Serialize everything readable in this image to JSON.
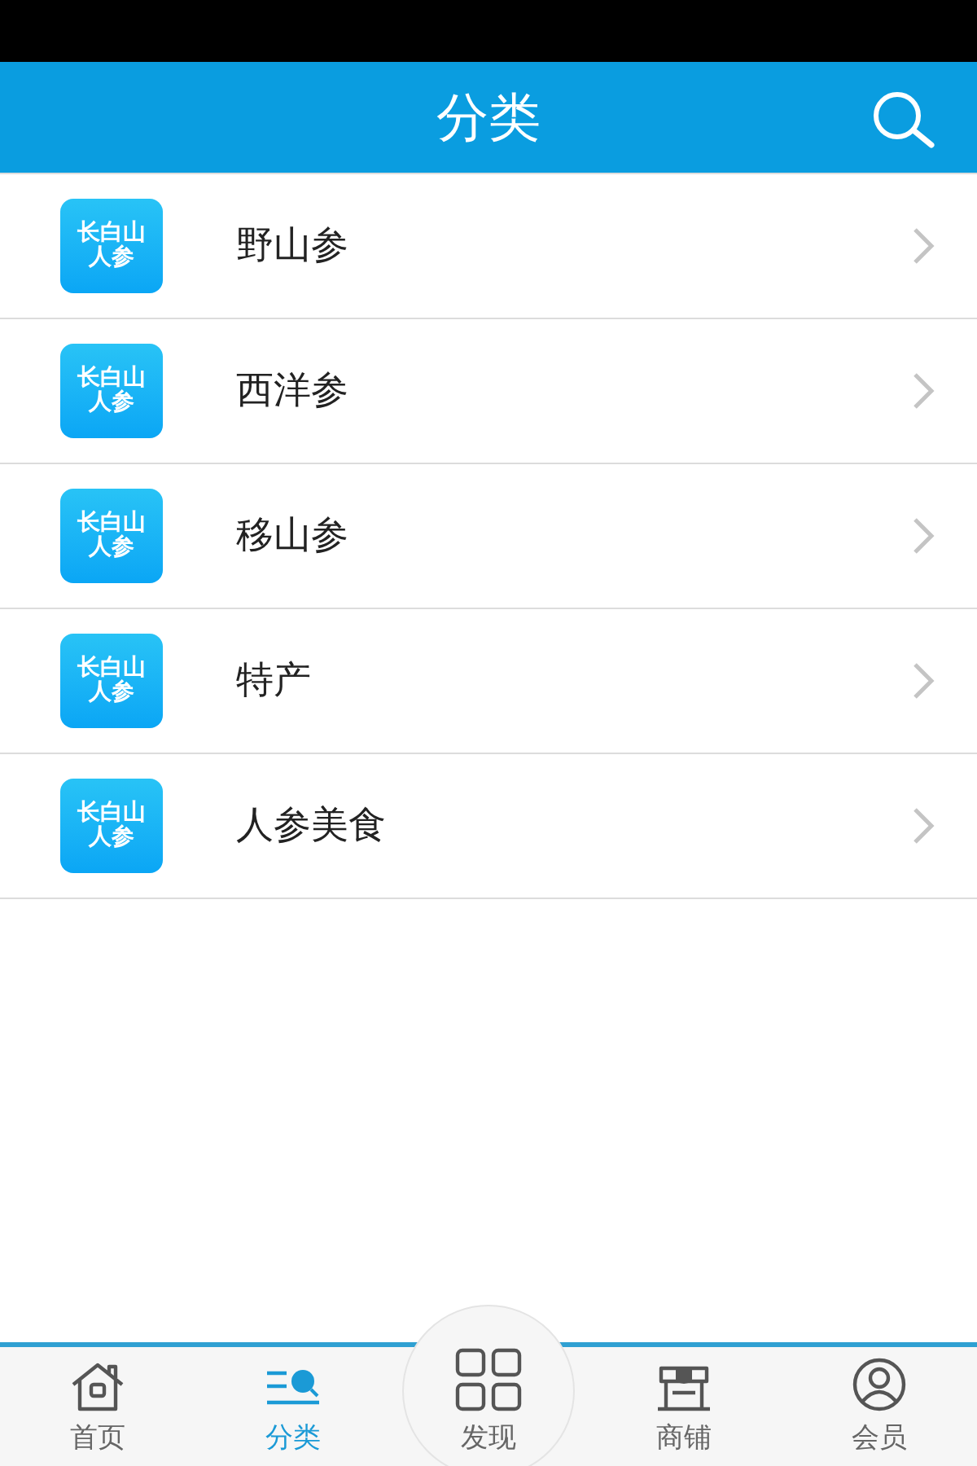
{
  "header": {
    "title": "分类"
  },
  "categories": [
    {
      "logo_line1": "长白山",
      "logo_line2": "人参",
      "label": "野山参"
    },
    {
      "logo_line1": "长白山",
      "logo_line2": "人参",
      "label": "西洋参"
    },
    {
      "logo_line1": "长白山",
      "logo_line2": "人参",
      "label": "移山参"
    },
    {
      "logo_line1": "长白山",
      "logo_line2": "人参",
      "label": "特产"
    },
    {
      "logo_line1": "长白山",
      "logo_line2": "人参",
      "label": "人参美食"
    }
  ],
  "tab_bar": [
    {
      "kind": "home",
      "label": "首页",
      "selected": false
    },
    {
      "kind": "category",
      "label": "分类",
      "selected": true
    },
    {
      "kind": "discover",
      "label": "发现",
      "selected": false
    },
    {
      "kind": "shop",
      "label": "商铺",
      "selected": false
    },
    {
      "kind": "member",
      "label": "会员",
      "selected": false
    }
  ]
}
